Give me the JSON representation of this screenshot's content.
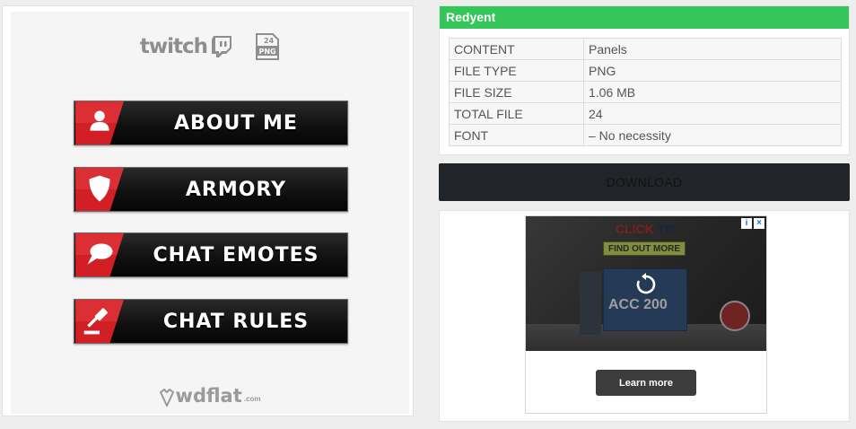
{
  "preview": {
    "twitch_logo_text": "twitch",
    "png_badge": {
      "count": "24",
      "format": "PNG"
    },
    "buttons": [
      {
        "label": "ABOUT ME",
        "icon": "user-icon"
      },
      {
        "label": "ARMORY",
        "icon": "shield-icon"
      },
      {
        "label": "CHAT EMOTES",
        "icon": "speech-bubble-icon"
      },
      {
        "label": "CHAT RULES",
        "icon": "gavel-icon"
      }
    ],
    "watermark": {
      "name": "wdflat",
      "domain": ".com"
    }
  },
  "info": {
    "title": "Redyent",
    "rows": [
      {
        "key": "CONTENT",
        "value": "Panels"
      },
      {
        "key": "FILE TYPE",
        "value": "PNG"
      },
      {
        "key": "FILE SIZE",
        "value": "1.06 MB"
      },
      {
        "key": "TOTAL FILE",
        "value": "24"
      },
      {
        "key": "FONT",
        "value": "– No necessity"
      }
    ]
  },
  "download": {
    "label": "DOWNLOAD"
  },
  "ad": {
    "headline_a": "CLICK",
    "headline_b": "TO",
    "sub": "FIND OUT MORE",
    "product": "ACC 200",
    "choices_info": "i",
    "choices_close": "×",
    "cta": "Learn more"
  },
  "colors": {
    "accent_green": "#34c659",
    "panel_red": "#d21f26",
    "download_bg": "#212529"
  }
}
